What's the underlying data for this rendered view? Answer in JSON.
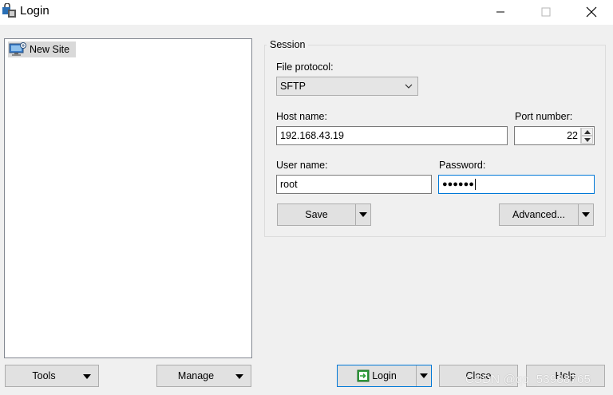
{
  "window": {
    "title": "Login"
  },
  "site_tree": {
    "items": [
      {
        "label": "New Site",
        "icon": "monitor-globe-icon"
      }
    ]
  },
  "session": {
    "legend": "Session",
    "file_protocol_label": "File protocol:",
    "file_protocol_value": "SFTP",
    "host_name_label": "Host name:",
    "host_name_value": "192.168.43.19",
    "port_label": "Port number:",
    "port_value": "22",
    "user_name_label": "User name:",
    "user_name_value": "root",
    "password_label": "Password:",
    "password_masked": "●●●●●●",
    "save_label": "Save",
    "advanced_label": "Advanced..."
  },
  "bottom": {
    "tools_label": "Tools",
    "manage_label": "Manage",
    "login_label": "Login",
    "close_label": "Close",
    "help_label": "Help"
  },
  "watermark": "CSDN @qq_53988765",
  "colors": {
    "focus_border": "#0078d7",
    "window_bg": "#f0f0f0",
    "tree_selected": "#d9d9d9"
  }
}
